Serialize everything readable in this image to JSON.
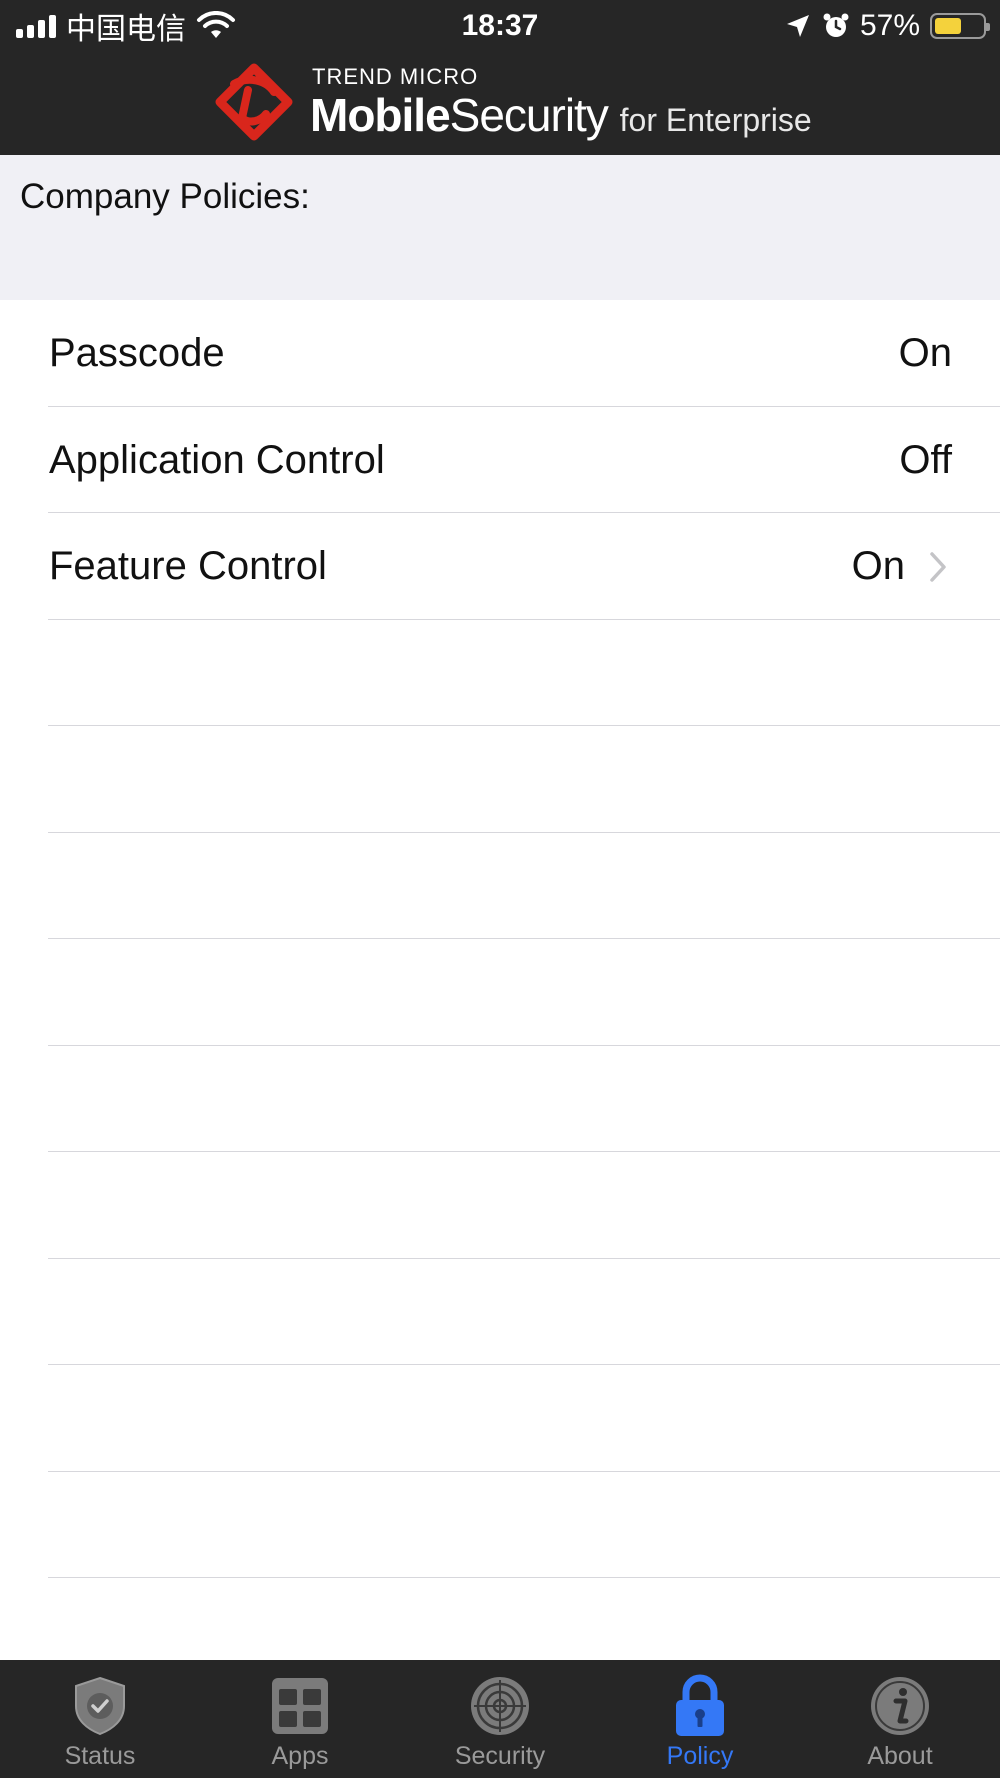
{
  "status_bar": {
    "carrier": "中国电信",
    "time": "18:37",
    "battery_percent": "57%",
    "battery_level": 0.57,
    "battery_color": "#f4d23c"
  },
  "header": {
    "brand_top": "TREND MICRO",
    "brand_mobile": "Mobile",
    "brand_security": "Security",
    "brand_enterprise": "for Enterprise",
    "logo_color": "#d9261c"
  },
  "section": {
    "title": "Company Policies:"
  },
  "policies": [
    {
      "label": "Passcode",
      "value": "On"
    },
    {
      "label": "Application Control",
      "value": "Off"
    },
    {
      "label": "Feature Control",
      "value": "On",
      "chevron": "chevron-right-icon"
    }
  ],
  "tabs": [
    {
      "label": "Status",
      "icon": "shield-check-icon"
    },
    {
      "label": "Apps",
      "icon": "apps-grid-icon"
    },
    {
      "label": "Security",
      "icon": "radar-icon"
    },
    {
      "label": "Policy",
      "icon": "lock-icon",
      "active": true
    },
    {
      "label": "About",
      "icon": "info-icon"
    }
  ],
  "colors": {
    "accent": "#3478f6",
    "bar_background": "#262626",
    "tab_inactive": "#9a9a9a"
  }
}
